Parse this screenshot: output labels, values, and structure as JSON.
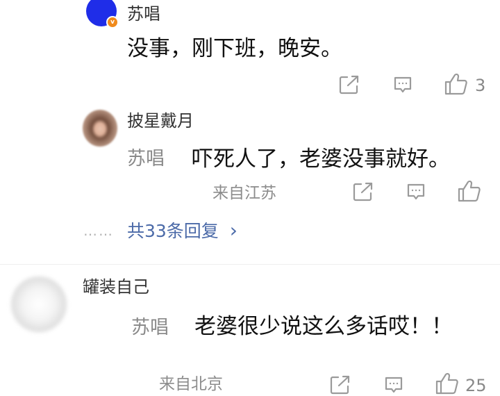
{
  "comment1": {
    "username": "苏唱",
    "text": "没事，刚下班，晚安。",
    "like_count": "3",
    "verified_badge": "v"
  },
  "reply1": {
    "username": "披星戴月",
    "mention": "苏唱",
    "text": "吓死人了，老婆没事就好。",
    "location": "来自江苏"
  },
  "replies_link": {
    "dots": "……",
    "label": "共33条回复",
    "chevron": "›"
  },
  "comment2": {
    "username": "罐装自己",
    "mention": "苏唱",
    "text": "老婆很少说这么多话哎！！",
    "location": "来自北京",
    "like_count": "25"
  },
  "colors": {
    "link_blue": "#4b6aa8",
    "icon_gray": "#9a9a9a",
    "avatar_blue": "#1f2de8",
    "badge_orange": "#f08a1c"
  },
  "icons": [
    "share-icon",
    "comment-icon",
    "like-icon"
  ]
}
